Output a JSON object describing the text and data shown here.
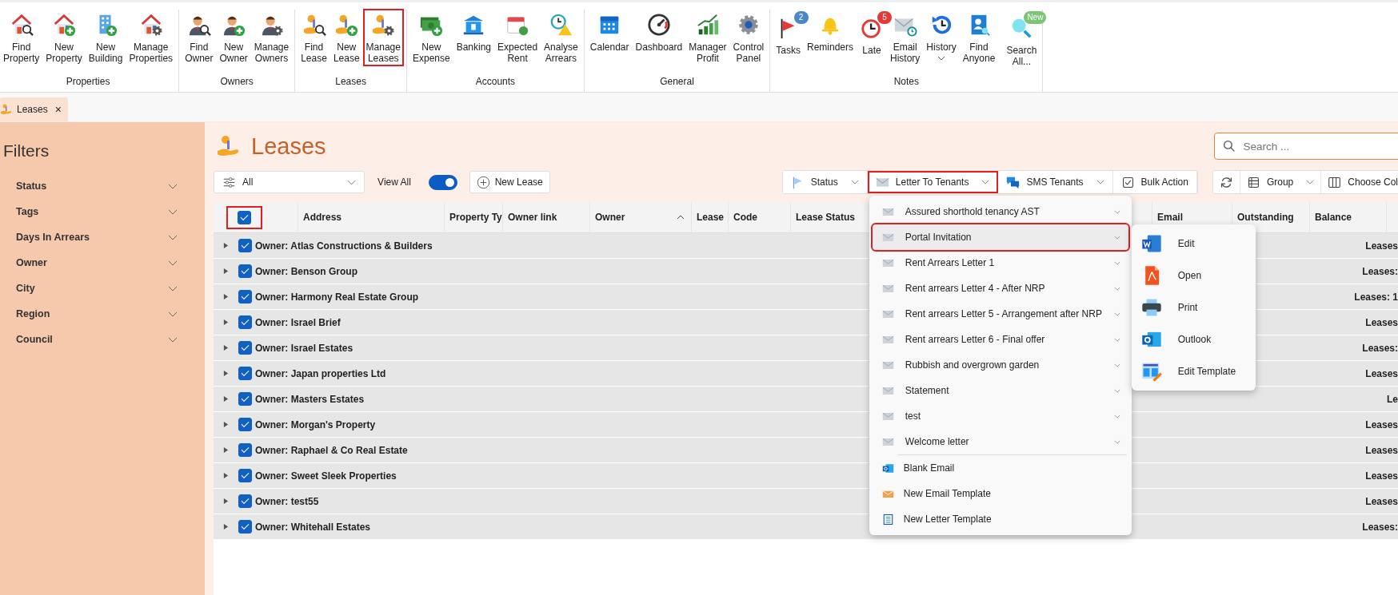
{
  "ribbon": {
    "groups": [
      {
        "label": "Properties",
        "buttons": [
          {
            "lines": [
              "Find",
              "Property"
            ],
            "highlighted": false,
            "dropdown": false
          },
          {
            "lines": [
              "New",
              "Property"
            ],
            "highlighted": false,
            "dropdown": false
          },
          {
            "lines": [
              "New",
              "Building"
            ],
            "highlighted": false,
            "dropdown": false
          },
          {
            "lines": [
              "Manage",
              "Properties"
            ],
            "highlighted": false,
            "dropdown": false
          }
        ]
      },
      {
        "label": "Owners",
        "buttons": [
          {
            "lines": [
              "Find",
              "Owner"
            ],
            "highlighted": false,
            "dropdown": false
          },
          {
            "lines": [
              "New",
              "Owner"
            ],
            "highlighted": false,
            "dropdown": false
          },
          {
            "lines": [
              "Manage",
              "Owners"
            ],
            "highlighted": false,
            "dropdown": false
          }
        ]
      },
      {
        "label": "Leases",
        "buttons": [
          {
            "lines": [
              "Find",
              "Lease"
            ],
            "highlighted": false,
            "dropdown": false
          },
          {
            "lines": [
              "New",
              "Lease"
            ],
            "highlighted": false,
            "dropdown": false
          },
          {
            "lines": [
              "Manage",
              "Leases"
            ],
            "highlighted": true,
            "dropdown": false
          }
        ]
      },
      {
        "label": "Accounts",
        "buttons": [
          {
            "lines": [
              "New",
              "Expense"
            ],
            "highlighted": false,
            "dropdown": false
          },
          {
            "lines": [
              "Banking"
            ],
            "highlighted": false,
            "dropdown": false
          },
          {
            "lines": [
              "Expected",
              "Rent"
            ],
            "highlighted": false,
            "dropdown": false
          },
          {
            "lines": [
              "Analyse",
              "Arrears"
            ],
            "highlighted": false,
            "dropdown": false
          }
        ]
      },
      {
        "label": "General",
        "buttons": [
          {
            "lines": [
              "Calendar"
            ],
            "highlighted": false,
            "dropdown": false
          },
          {
            "lines": [
              "Dashboard"
            ],
            "highlighted": false,
            "dropdown": false
          },
          {
            "lines": [
              "Manager",
              "Profit"
            ],
            "highlighted": false,
            "dropdown": false
          },
          {
            "lines": [
              "Control",
              "Panel"
            ],
            "highlighted": false,
            "dropdown": false
          }
        ]
      },
      {
        "label": "Notes",
        "buttons": [
          {
            "lines": [
              "Tasks"
            ],
            "highlighted": false,
            "dropdown": false,
            "badge": {
              "text": "2",
              "color": "#4a86c8"
            }
          },
          {
            "lines": [
              "Reminders"
            ],
            "highlighted": false,
            "dropdown": false
          },
          {
            "lines": [
              "Late"
            ],
            "highlighted": false,
            "dropdown": false,
            "badge": {
              "text": "5",
              "color": "#e53935"
            }
          },
          {
            "lines": [
              "Email",
              "History"
            ],
            "highlighted": false,
            "dropdown": false
          },
          {
            "lines": [
              "History"
            ],
            "highlighted": false,
            "dropdown": true
          },
          {
            "lines": [
              "Find",
              "Anyone"
            ],
            "highlighted": false,
            "dropdown": false
          },
          {
            "lines": [
              "Search",
              "All..."
            ],
            "highlighted": false,
            "dropdown": false,
            "badge": {
              "text": "New",
              "color": "#7cc576"
            }
          }
        ]
      }
    ]
  },
  "tabs": [
    {
      "label": "Leases",
      "close": "×",
      "selected": true
    }
  ],
  "sidebar": {
    "title": "Filters",
    "items": [
      {
        "label": "Status"
      },
      {
        "label": "Tags"
      },
      {
        "label": "Days In Arrears"
      },
      {
        "label": "Owner"
      },
      {
        "label": "City"
      },
      {
        "label": "Region"
      },
      {
        "label": "Council"
      }
    ]
  },
  "page": {
    "title": "Leases",
    "search": {
      "placeholder": "Search ..."
    }
  },
  "toolbar": {
    "filter": {
      "value": "All"
    },
    "view_all": {
      "label": "View All",
      "on": true
    },
    "new_button": "New Lease",
    "actions": [
      {
        "label": "Status",
        "dropdown": true,
        "highlighted": false
      },
      {
        "label": "Letter To Tenants",
        "dropdown": true,
        "highlighted": true
      },
      {
        "label": "SMS Tenants",
        "dropdown": true,
        "highlighted": false
      },
      {
        "label": "Bulk Action",
        "dropdown": false,
        "highlighted": false
      }
    ],
    "view_actions": [
      {
        "dropdown": false
      },
      {
        "label": "Group",
        "dropdown": true
      },
      {
        "label": "Choose Col",
        "dropdown": false
      }
    ]
  },
  "table": {
    "select_all": {
      "checked": true,
      "highlighted": true
    },
    "columns": [
      {
        "label": "Address"
      },
      {
        "label": "Property Ty"
      },
      {
        "label": "Owner link"
      },
      {
        "label": "Owner",
        "sorted": true
      },
      {
        "label": "Lease"
      },
      {
        "label": "Code"
      },
      {
        "label": "Lease Status"
      },
      {
        "label": "Email"
      },
      {
        "label": "Outstanding"
      },
      {
        "label": "Balance"
      }
    ],
    "rows": [
      {
        "label": "Owner: Atlas Constructions & Builders",
        "checked": true,
        "expanded": false,
        "summary": "Leases"
      },
      {
        "label": "Owner: Benson Group",
        "checked": true,
        "expanded": false,
        "summary": "Leases:"
      },
      {
        "label": "Owner: Harmony Real Estate Group",
        "checked": true,
        "expanded": false,
        "summary": "Leases: 1"
      },
      {
        "label": "Owner: Israel Brief",
        "checked": true,
        "expanded": false,
        "summary": "Leases"
      },
      {
        "label": "Owner: Israel Estates",
        "checked": true,
        "expanded": false,
        "summary": "Leases:"
      },
      {
        "label": "Owner: Japan properties Ltd",
        "checked": true,
        "expanded": false,
        "summary": "Leases"
      },
      {
        "label": "Owner: Masters Estates",
        "checked": true,
        "expanded": false,
        "summary": "Le"
      },
      {
        "label": "Owner: Morgan's Property",
        "checked": true,
        "expanded": false,
        "summary": "Leases"
      },
      {
        "label": "Owner: Raphael & Co Real Estate",
        "checked": true,
        "expanded": false,
        "summary": "Leases"
      },
      {
        "label": "Owner: Sweet Sleek Properties",
        "checked": true,
        "expanded": false,
        "summary": "Leases"
      },
      {
        "label": "Owner: test55",
        "checked": true,
        "expanded": false,
        "summary": "Leases"
      },
      {
        "label": "Owner: Whitehall Estates",
        "checked": true,
        "expanded": false,
        "summary": "Leases:"
      }
    ]
  },
  "letter_menu": {
    "items": [
      {
        "kind": "template",
        "label": "Assured shorthold tenancy AST",
        "selected": false,
        "highlighted": false
      },
      {
        "kind": "template",
        "label": "Portal Invitation",
        "selected": true,
        "highlighted": true,
        "submenu": [
          {
            "label": "Edit"
          },
          {
            "label": "Open"
          },
          {
            "label": "Print"
          },
          {
            "label": "Outlook"
          },
          {
            "label": "Edit Template"
          }
        ]
      },
      {
        "kind": "template",
        "label": "Rent Arrears Letter 1",
        "selected": false,
        "highlighted": false
      },
      {
        "kind": "template",
        "label": "Rent arrears Letter 4 - After NRP",
        "selected": false,
        "highlighted": false
      },
      {
        "kind": "template",
        "label": "Rent arrears Letter 5 - Arrangement after NRP",
        "selected": false,
        "highlighted": false
      },
      {
        "kind": "template",
        "label": "Rent arrears Letter 6 - Final offer",
        "selected": false,
        "highlighted": false
      },
      {
        "kind": "template",
        "label": "Rubbish and overgrown garden",
        "selected": false,
        "highlighted": false
      },
      {
        "kind": "template",
        "label": "Statement",
        "selected": false,
        "highlighted": false
      },
      {
        "kind": "template",
        "label": "test",
        "selected": false,
        "highlighted": false
      },
      {
        "kind": "template",
        "label": "Welcome letter",
        "selected": false,
        "highlighted": false
      },
      {
        "kind": "action",
        "label": "Blank Email",
        "selected": false,
        "highlighted": false
      },
      {
        "kind": "action",
        "label": "New Email Template",
        "selected": false,
        "highlighted": false
      },
      {
        "kind": "action",
        "label": "New Letter Template",
        "selected": false,
        "highlighted": false
      }
    ]
  }
}
